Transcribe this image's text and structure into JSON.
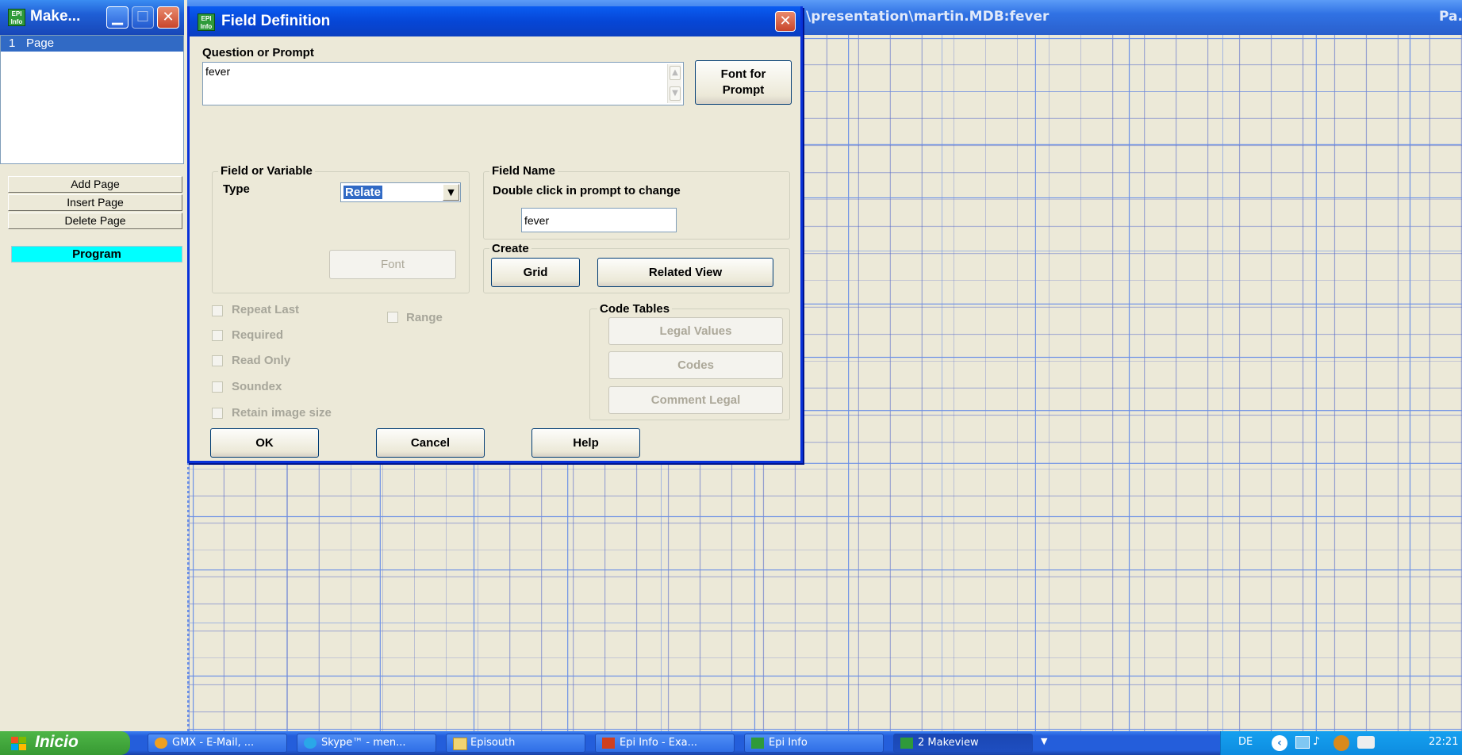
{
  "left_window": {
    "title": "Make...",
    "page_list": [
      {
        "num": "1",
        "label": "Page"
      }
    ],
    "buttons": {
      "add_page": "Add Page",
      "insert_page": "Insert Page",
      "delete_page": "Delete Page",
      "program": "Program"
    }
  },
  "main_window": {
    "title_path": "\\presentation\\martin.MDB:fever",
    "title_right": "Pa..."
  },
  "dialog": {
    "title": "Field Definition",
    "question_label": "Question or Prompt",
    "question_value": "fever",
    "font_for_prompt": "Font for\nPrompt",
    "field_var_group": "Field or Variable",
    "type_label": "Type",
    "type_value": "Relate",
    "font_button": "Font",
    "field_name_group": "Field Name",
    "field_name_hint": "Double click in prompt to change",
    "field_name_value": "fever",
    "create_group": "Create",
    "grid_button": "Grid",
    "related_view_button": "Related View",
    "checkboxes": {
      "repeat_last": "Repeat Last",
      "range": "Range",
      "required": "Required",
      "read_only": "Read Only",
      "soundex": "Soundex",
      "retain_image_size": "Retain image size"
    },
    "code_tables_group": "Code Tables",
    "legal_values": "Legal Values",
    "codes": "Codes",
    "comment_legal": "Comment Legal",
    "ok": "OK",
    "cancel": "Cancel",
    "help": "Help"
  },
  "taskbar": {
    "start": "Inicio",
    "tasks": [
      "GMX - E-Mail, ...",
      "Skype™ - men...",
      "Episouth",
      "Epi Info - Exa...",
      "Epi Info",
      "2 Makeview"
    ],
    "language": "DE",
    "clock": "22:21"
  },
  "colors": {
    "title_blue": "#0a5df2",
    "program_highlight": "#00ffff",
    "selection_blue": "#316ac5",
    "grid_line": "#6a8fe6",
    "dialog_bg": "#ece9d8"
  }
}
